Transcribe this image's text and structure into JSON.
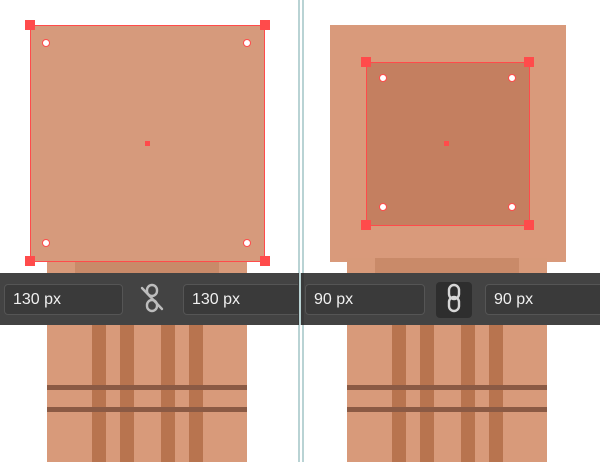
{
  "left_panel": {
    "width_value": "130 px",
    "height_value": "130 px",
    "constrain_proportions": false
  },
  "right_panel": {
    "width_value": "90 px",
    "height_value": "90 px",
    "constrain_proportions": true
  },
  "icons": {
    "left_link": "unlink-icon",
    "right_link": "link-icon"
  },
  "colors": {
    "selection": "#ff4b4b",
    "toolbar_bg": "#434343",
    "field_bg": "#3a3a3a"
  }
}
